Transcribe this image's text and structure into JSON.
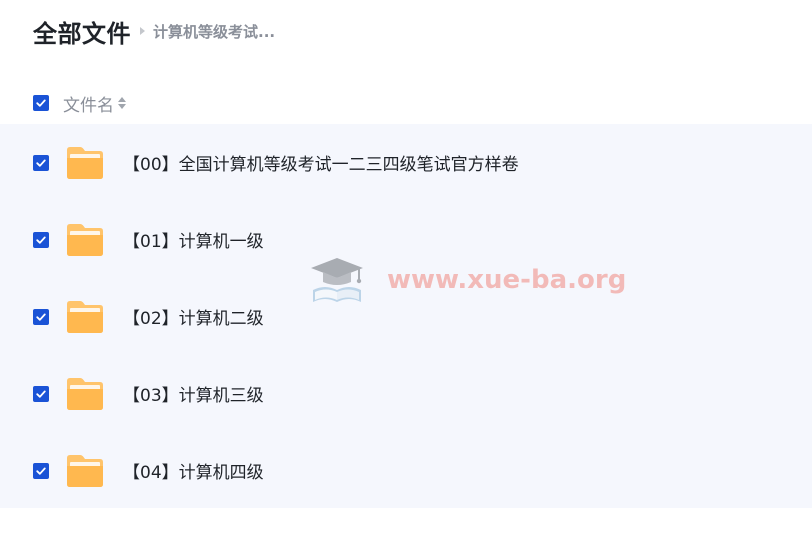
{
  "breadcrumb": {
    "root": "全部文件",
    "current": "计算机等级考试..."
  },
  "list": {
    "header": {
      "column_label": "文件名",
      "select_all_checked": true
    },
    "rows": [
      {
        "name": "【00】全国计算机等级考试一二三四级笔试官方样卷",
        "checked": true
      },
      {
        "name": "【01】计算机一级",
        "checked": true
      },
      {
        "name": "【02】计算机二级",
        "checked": true
      },
      {
        "name": "【03】计算机三级",
        "checked": true
      },
      {
        "name": "【04】计算机四级",
        "checked": true
      }
    ]
  },
  "watermark": {
    "text": "www.xue-ba.org"
  },
  "colors": {
    "accent": "#1a53d6",
    "folder": "#ffc46b",
    "row_background": "#f5f7fd",
    "watermark": "#f08a80"
  },
  "icons": {
    "checkbox": "check-icon",
    "folder": "folder-icon",
    "sort": "sort-icon",
    "separator": "chevron-right-icon",
    "watermark_logo": "graduation-cap-icon"
  }
}
